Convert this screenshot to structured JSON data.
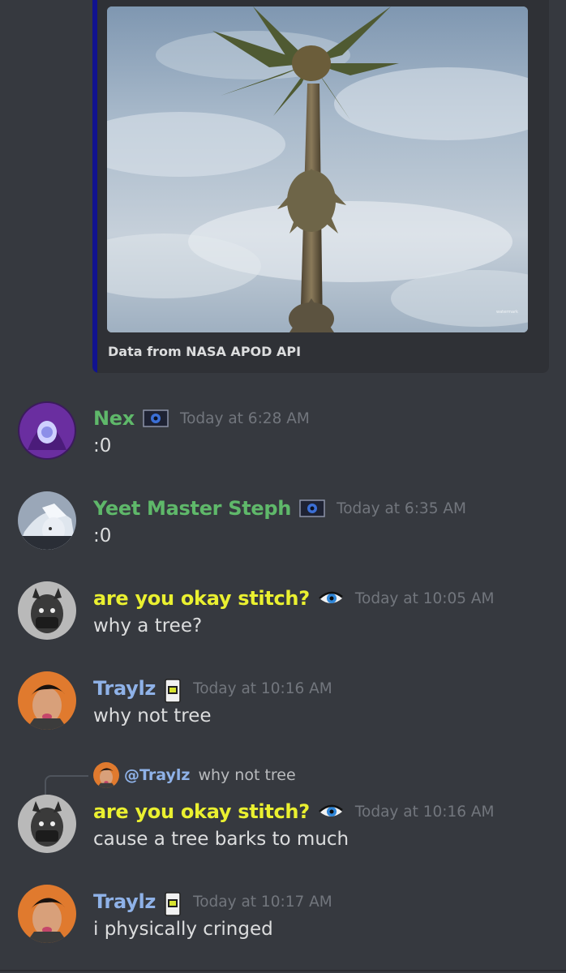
{
  "theme": {
    "background": "#36393f",
    "embed_background": "#2f3136",
    "embed_accent": "#11138f",
    "text": "#dcddde",
    "muted": "#72767d"
  },
  "embed": {
    "footer": "Data from NASA APOD API",
    "image_icon": "palm-tree-photo"
  },
  "messages": [
    {
      "username": "Nex",
      "username_color": "#5fb86a",
      "badge_icon": "blue-eye-badge-icon",
      "timestamp": "Today at 6:28 AM",
      "content": ":0"
    },
    {
      "username": "Yeet Master Steph",
      "username_color": "#5fb86a",
      "badge_icon": "blue-eye-badge-icon",
      "timestamp": "Today at 6:35 AM",
      "content": ":0"
    },
    {
      "username": "are you okay stitch?",
      "username_color": "#eaf030",
      "badge_icon": "eye-emoji-icon",
      "timestamp": "Today at 10:05 AM",
      "content": "why a tree?"
    },
    {
      "username": "Traylz",
      "username_color": "#8fb2e8",
      "badge_icon": "phone-badge-icon",
      "timestamp": "Today at 10:16 AM",
      "content": "why not tree"
    },
    {
      "username": "are you okay stitch?",
      "username_color": "#eaf030",
      "badge_icon": "eye-emoji-icon",
      "timestamp": "Today at 10:16 AM",
      "content": "cause a tree barks to much",
      "reply": {
        "mention": "@Traylz",
        "text": "why not tree"
      }
    },
    {
      "username": "Traylz",
      "username_color": "#8fb2e8",
      "badge_icon": "phone-badge-icon",
      "timestamp": "Today at 10:17 AM",
      "content": "i physically cringed"
    }
  ]
}
